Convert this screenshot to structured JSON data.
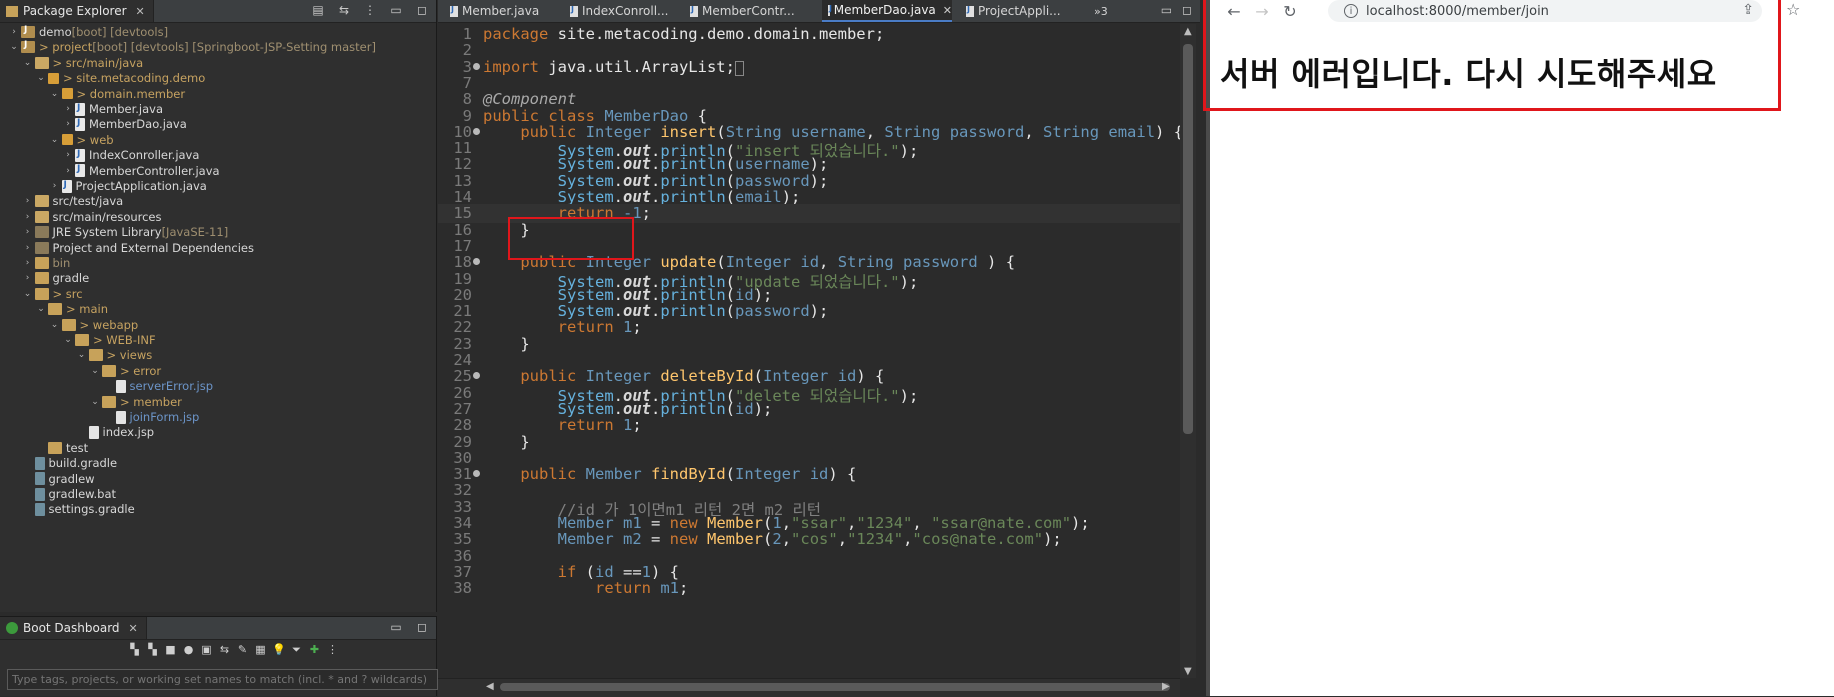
{
  "package_explorer": {
    "title": "Package Explorer",
    "tree": [
      {
        "indent": 0,
        "arrow": "›",
        "icon": "proj",
        "label": "demo",
        "decor": " [boot] [devtools]"
      },
      {
        "indent": 0,
        "arrow": "⌄",
        "icon": "proj",
        "label": "> project",
        "decor": " [boot] [devtools] [Springboot-JSP-Setting master]"
      },
      {
        "indent": 1,
        "arrow": "⌄",
        "icon": "srcfolder",
        "label": "> src/main/java",
        "decor": ""
      },
      {
        "indent": 2,
        "arrow": "⌄",
        "icon": "pkg",
        "label": "> site.metacoding.demo",
        "decor": ""
      },
      {
        "indent": 3,
        "arrow": "⌄",
        "icon": "pkg",
        "label": "> domain.member",
        "decor": ""
      },
      {
        "indent": 4,
        "arrow": "›",
        "icon": "java",
        "label": "Member.java",
        "decor": ""
      },
      {
        "indent": 4,
        "arrow": "›",
        "icon": "java",
        "label": "MemberDao.java",
        "decor": ""
      },
      {
        "indent": 3,
        "arrow": "⌄",
        "icon": "pkg",
        "label": "> web",
        "decor": ""
      },
      {
        "indent": 4,
        "arrow": "›",
        "icon": "java",
        "label": "IndexConroller.java",
        "decor": ""
      },
      {
        "indent": 4,
        "arrow": "›",
        "icon": "java",
        "label": "MemberController.java",
        "decor": ""
      },
      {
        "indent": 3,
        "arrow": "›",
        "icon": "java",
        "label": "ProjectApplication.java",
        "decor": ""
      },
      {
        "indent": 1,
        "arrow": "›",
        "icon": "srcfolder",
        "label": "src/test/java",
        "decor": ""
      },
      {
        "indent": 1,
        "arrow": "›",
        "icon": "srcfolder",
        "label": "src/main/resources",
        "decor": ""
      },
      {
        "indent": 1,
        "arrow": "›",
        "icon": "lib",
        "label": "JRE System Library",
        "decor": " [JavaSE-11]"
      },
      {
        "indent": 1,
        "arrow": "›",
        "icon": "lib",
        "label": "Project and External Dependencies",
        "decor": ""
      },
      {
        "indent": 1,
        "arrow": "›",
        "icon": "folder",
        "label": "bin",
        "decor": ""
      },
      {
        "indent": 1,
        "arrow": "›",
        "icon": "folder",
        "label": "gradle",
        "decor": ""
      },
      {
        "indent": 1,
        "arrow": "⌄",
        "icon": "folder",
        "label": "> src",
        "decor": ""
      },
      {
        "indent": 2,
        "arrow": "⌄",
        "icon": "folder",
        "label": "> main",
        "decor": ""
      },
      {
        "indent": 3,
        "arrow": "⌄",
        "icon": "folder",
        "label": "> webapp",
        "decor": ""
      },
      {
        "indent": 4,
        "arrow": "⌄",
        "icon": "folder",
        "label": "> WEB-INF",
        "decor": ""
      },
      {
        "indent": 5,
        "arrow": "⌄",
        "icon": "folder",
        "label": "> views",
        "decor": ""
      },
      {
        "indent": 6,
        "arrow": "⌄",
        "icon": "folder",
        "label": "> error",
        "decor": ""
      },
      {
        "indent": 7,
        "arrow": "",
        "icon": "file",
        "label": "serverError.jsp",
        "decor": ""
      },
      {
        "indent": 6,
        "arrow": "⌄",
        "icon": "folder",
        "label": "> member",
        "decor": ""
      },
      {
        "indent": 7,
        "arrow": "",
        "icon": "file",
        "label": "joinForm.jsp",
        "decor": ""
      },
      {
        "indent": 5,
        "arrow": "",
        "icon": "file",
        "label": "index.jsp",
        "decor": ""
      },
      {
        "indent": 2,
        "arrow": "",
        "icon": "folder",
        "label": "test",
        "decor": ""
      },
      {
        "indent": 1,
        "arrow": "",
        "icon": "gradle",
        "label": "build.gradle",
        "decor": ""
      },
      {
        "indent": 1,
        "arrow": "",
        "icon": "gradle",
        "label": "gradlew",
        "decor": ""
      },
      {
        "indent": 1,
        "arrow": "",
        "icon": "gradle",
        "label": "gradlew.bat",
        "decor": ""
      },
      {
        "indent": 1,
        "arrow": "",
        "icon": "gradle",
        "label": "settings.gradle",
        "decor": ""
      }
    ]
  },
  "boot_dashboard": {
    "title": "Boot Dashboard",
    "filter_placeholder": "Type tags, projects, or working set names to match (incl. * and ? wildcards)"
  },
  "editor": {
    "tabs": [
      "Member.java",
      "IndexConroll...",
      "MemberContr...",
      "MemberDao.java",
      "ProjectAppli..."
    ],
    "active_tab": "MemberDao.java",
    "overflow": "»3",
    "lines": [
      {
        "n": "1",
        "html": "<span class='kw'>package</span> site.metacoding.demo.domain.member;"
      },
      {
        "n": "2",
        "html": ""
      },
      {
        "n": "3",
        "fold": true,
        "html": "<span class='kw'>import</span> java.util.ArrayList;<span style='border:1px solid #888;font-size:11px;'>&nbsp;</span>"
      },
      {
        "n": "7",
        "html": ""
      },
      {
        "n": "8",
        "html": "<span class='an'>@Component</span>"
      },
      {
        "n": "9",
        "html": "<span class='kw'>public class</span> <span class='ty'>MemberDao</span> {"
      },
      {
        "n": "10",
        "fold": true,
        "html": "    <span class='kw'>public</span> <span class='ty'>Integer</span> <span class='fn'>insert</span>(<span class='ty'>String</span> <span class='nm'>username</span>, <span class='ty'>String</span> <span class='nm'>password</span>, <span class='ty'>String</span> <span class='nm'>email</span>) {"
      },
      {
        "n": "11",
        "html": "        <span class='sys'>System</span>.<span class='out'>out</span>.<span class='sys'>println</span>(<span class='st'>\"insert 되었습니다.\"</span>);"
      },
      {
        "n": "12",
        "html": "        <span class='sys'>System</span>.<span class='out'>out</span>.<span class='sys'>println</span>(<span class='nm'>username</span>);"
      },
      {
        "n": "13",
        "html": "        <span class='sys'>System</span>.<span class='out'>out</span>.<span class='sys'>println</span>(<span class='nm'>password</span>);"
      },
      {
        "n": "14",
        "html": "        <span class='sys'>System</span>.<span class='out'>out</span>.<span class='sys'>println</span>(<span class='nm'>email</span>);"
      },
      {
        "n": "15",
        "current": true,
        "html": "        <span class='kw'>return</span> <span class='nm'>-1</span>;"
      },
      {
        "n": "16",
        "html": "    }"
      },
      {
        "n": "17",
        "html": ""
      },
      {
        "n": "18",
        "fold": true,
        "html": "    <span class='kw'>public</span> <span class='ty'>Integer</span> <span class='fn'>update</span>(<span class='ty'>Integer</span> <span class='nm'>id</span>, <span class='ty'>String</span> <span class='nm'>password</span> ) {"
      },
      {
        "n": "19",
        "html": "        <span class='sys'>System</span>.<span class='out'>out</span>.<span class='sys'>println</span>(<span class='st'>\"update 되었습니다.\"</span>);"
      },
      {
        "n": "20",
        "html": "        <span class='sys'>System</span>.<span class='out'>out</span>.<span class='sys'>println</span>(<span class='nm'>id</span>);"
      },
      {
        "n": "21",
        "html": "        <span class='sys'>System</span>.<span class='out'>out</span>.<span class='sys'>println</span>(<span class='nm'>password</span>);"
      },
      {
        "n": "22",
        "html": "        <span class='kw'>return</span> <span class='nm'>1</span>;"
      },
      {
        "n": "23",
        "html": "    }"
      },
      {
        "n": "24",
        "html": ""
      },
      {
        "n": "25",
        "fold": true,
        "html": "    <span class='kw'>public</span> <span class='ty'>Integer</span> <span class='fn'>deleteById</span>(<span class='ty'>Integer</span> <span class='nm'>id</span>) {"
      },
      {
        "n": "26",
        "html": "        <span class='sys'>System</span>.<span class='out'>out</span>.<span class='sys'>println</span>(<span class='st'>\"delete 되었습니다.\"</span>);"
      },
      {
        "n": "27",
        "html": "        <span class='sys'>System</span>.<span class='out'>out</span>.<span class='sys'>println</span>(<span class='nm'>id</span>);"
      },
      {
        "n": "28",
        "html": "        <span class='kw'>return</span> <span class='nm'>1</span>;"
      },
      {
        "n": "29",
        "html": "    }"
      },
      {
        "n": "30",
        "html": ""
      },
      {
        "n": "31",
        "fold": true,
        "html": "    <span class='kw'>public</span> <span class='ty'>Member</span> <span class='fn'>findById</span>(<span class='ty'>Integer</span> <span class='nm'>id</span>) {"
      },
      {
        "n": "32",
        "html": ""
      },
      {
        "n": "33",
        "html": "        <span class='cm'>//id 가 1이면m1 리턴 2면 m2 리턴</span>"
      },
      {
        "n": "34",
        "html": "        <span class='ty'>Member</span> <span class='nm'>m1</span> = <span class='kw'>new</span> <span class='fn'>Member</span>(<span class='nm'>1</span>,<span class='st'>\"ssar\"</span>,<span class='st'>\"1234\"</span>, <span class='st'>\"ssar@nate.com\"</span>);"
      },
      {
        "n": "35",
        "html": "        <span class='ty'>Member</span> <span class='nm'>m2</span> = <span class='kw'>new</span> <span class='fn'>Member</span>(<span class='nm'>2</span>,<span class='st'>\"cos\"</span>,<span class='st'>\"1234\"</span>,<span class='st'>\"cos@nate.com\"</span>);"
      },
      {
        "n": "36",
        "html": ""
      },
      {
        "n": "37",
        "html": "        <span class='kw'>if</span> (<span class='nm'>id</span> ==<span class='nm'>1</span>) {"
      },
      {
        "n": "38",
        "html": "            <span class='kw'>return</span> <span class='nm'>m1</span>;"
      }
    ]
  },
  "browser": {
    "url": "localhost:8000/member/join",
    "message": "서버 에러입니다. 다시 시도해주세요"
  },
  "colors": {
    "highlight_box": "#e0161b",
    "ide_bg": "#2b2b2b"
  }
}
